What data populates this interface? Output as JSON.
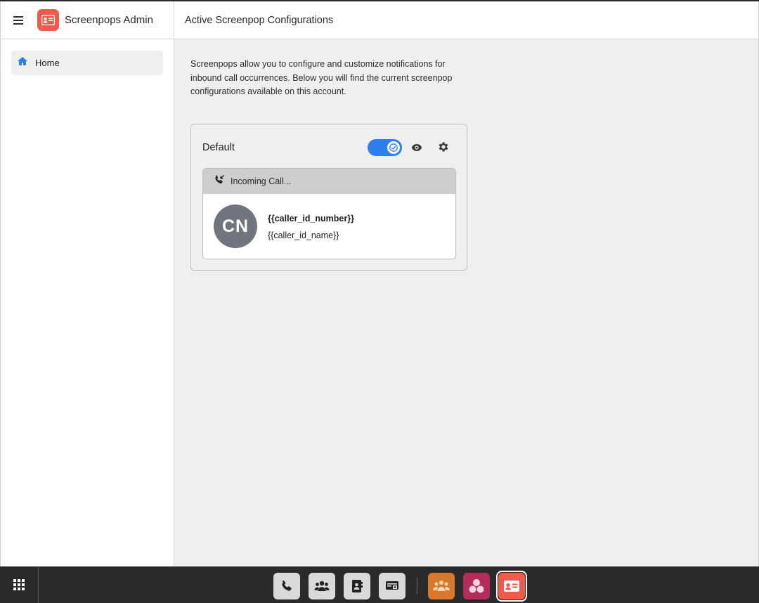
{
  "sidebar": {
    "menu_icon": "hamburger-menu-icon",
    "app_icon": "contact-card-icon",
    "app_title": "Screenpops Admin",
    "items": [
      {
        "label": "Home",
        "icon": "home-icon",
        "active": true
      }
    ]
  },
  "header": {
    "title": "Active Screenpop Configurations"
  },
  "main": {
    "intro_text": "Screenpops allow you to configure and customize notifications for inbound call occurrences. Below you will find the current screenpop configurations available on this account.",
    "configs": [
      {
        "name": "Default",
        "enabled": true,
        "preview": {
          "header_label": "Incoming Call...",
          "avatar_initials": "CN",
          "caller_number": "{{caller_id_number}}",
          "caller_name": "{{caller_id_name}}"
        }
      }
    ]
  },
  "taskbar": {
    "apps": [
      {
        "icon": "phone-icon"
      },
      {
        "icon": "group-icon"
      },
      {
        "icon": "contacts-book-icon"
      },
      {
        "icon": "fax-icon"
      },
      {
        "icon": "team-icon"
      },
      {
        "icon": "circles-icon"
      },
      {
        "icon": "screenpops-icon",
        "active": true
      }
    ]
  },
  "colors": {
    "accent": "#2d7ff0",
    "brand": "#ef5a4a",
    "avatar_bg": "#707580",
    "dock_orange": "#d9782a",
    "dock_magenta": "#b72a5c"
  }
}
